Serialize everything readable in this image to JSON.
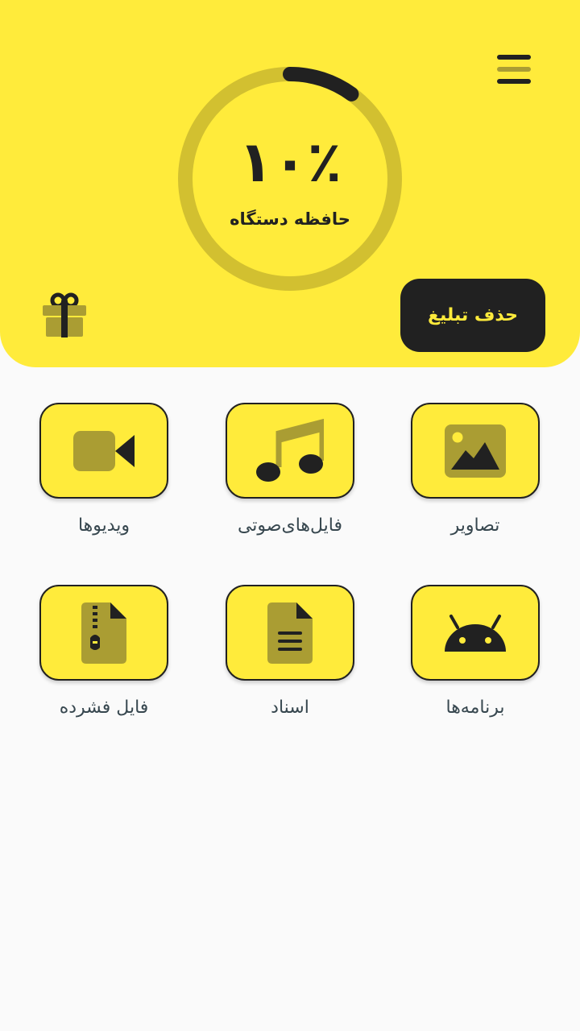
{
  "storage": {
    "percent_text": "۱۰٪",
    "label": "حافظه دستگاه",
    "percent": 10
  },
  "header": {
    "remove_ads_label": "حذف تبلیغ"
  },
  "categories": [
    {
      "label": "تصاویر",
      "icon": "image-icon"
    },
    {
      "label": "فایل‌های‌صوتی",
      "icon": "music-note-icon"
    },
    {
      "label": "ویدیوها",
      "icon": "video-camera-icon"
    },
    {
      "label": "برنامه‌ها",
      "icon": "android-icon"
    },
    {
      "label": "اسناد",
      "icon": "document-icon"
    },
    {
      "label": "فایل فشرده",
      "icon": "zip-file-icon"
    }
  ],
  "colors": {
    "accent": "#ffeb3b",
    "dark": "#212121",
    "icon_muted": "#aa9d33",
    "ring_track": "#d2c030",
    "label_text": "#37474f",
    "background": "#fafafa"
  }
}
